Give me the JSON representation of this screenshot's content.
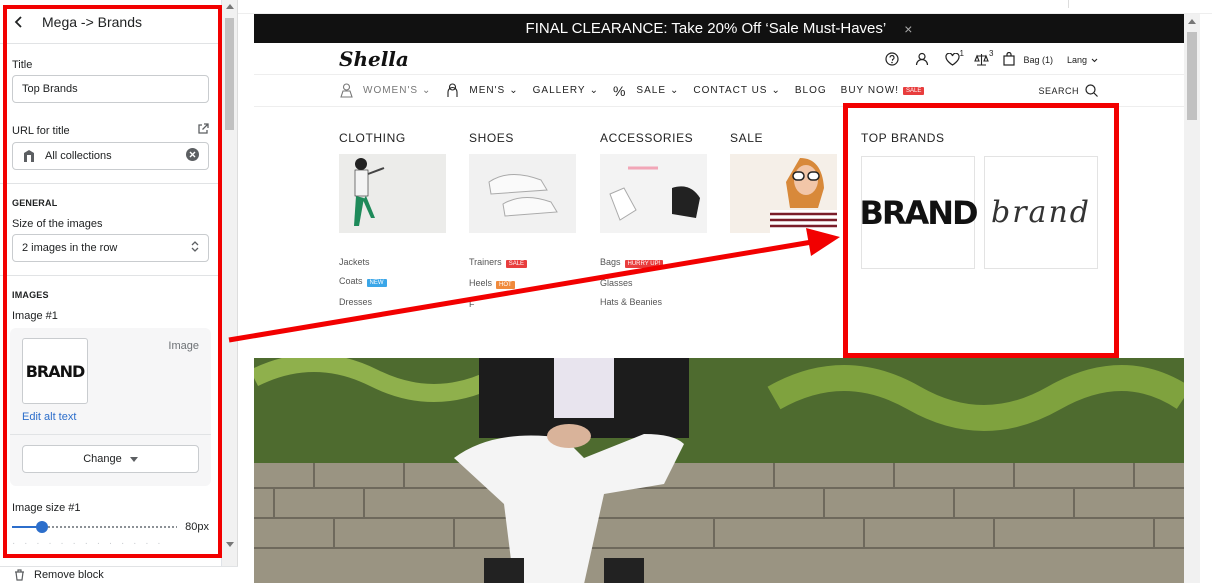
{
  "panel": {
    "header_title": "Mega -> Brands",
    "title_label": "Title",
    "title_value": "Top Brands",
    "url_label": "URL for title",
    "url_value": "All collections",
    "general_heading": "GENERAL",
    "size_label": "Size of the images",
    "size_value": "2 images in the row",
    "images_heading": "IMAGES",
    "image1_label": "Image #1",
    "image_caption": "Image",
    "thumb_text": "BRAND",
    "edit_alt": "Edit alt text",
    "change_label": "Change",
    "image_size_label": "Image size #1",
    "image_size_value": "80px",
    "image_size_level": 0.18,
    "remove_label": "Remove block"
  },
  "store": {
    "promo": "FINAL CLEARANCE: Take 20% Off ‘Sale Must-Haves’",
    "promo_close": "×",
    "logo": "Shella",
    "wishlist_count": "1",
    "compare_count": "3",
    "bag": "Bag (1)",
    "lang": "Lang",
    "nav": [
      "WOMEN'S",
      "MEN'S",
      "GALLERY",
      "SALE",
      "CONTACT US",
      "BLOG",
      "BUY NOW!"
    ],
    "nav_badge": "SALE",
    "search": "SEARCH",
    "columns": [
      {
        "title": "CLOTHING",
        "links": [
          "Jackets",
          "Coats",
          "Dresses"
        ],
        "badges": [
          "",
          "NEW",
          ""
        ]
      },
      {
        "title": "SHOES",
        "links": [
          "Trainers",
          "Heels",
          "F"
        ],
        "badges": [
          "SALE",
          "HOT",
          ""
        ]
      },
      {
        "title": "ACCESSORIES",
        "links": [
          "Bags",
          "Glasses",
          "Hats & Beanies"
        ],
        "badges": [
          "HURRY UP!",
          "",
          ""
        ]
      },
      {
        "title": "SALE"
      }
    ],
    "brands_title": "TOP BRANDS",
    "brand1": "BRAND",
    "brand2": "brand"
  },
  "colors": {
    "highlight_red": "#f20000",
    "badge_sale": "#e83d3d",
    "badge_new": "#3aa6e8",
    "badge_hot": "#f08a3c",
    "link_blue": "#2c6ecb"
  }
}
